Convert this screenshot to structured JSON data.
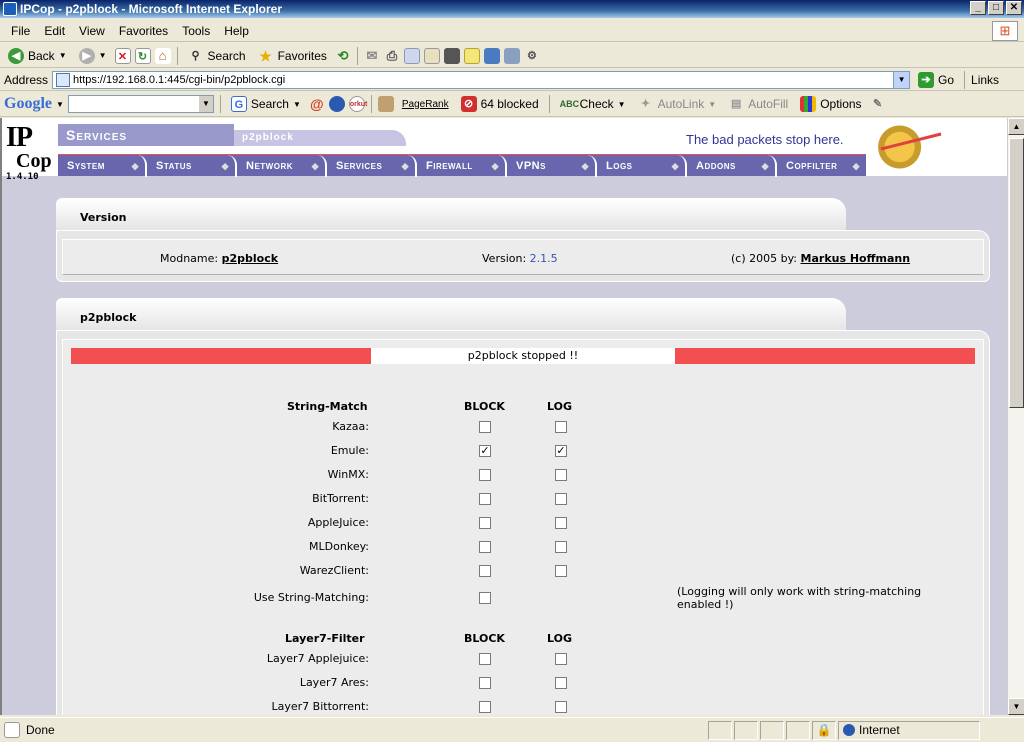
{
  "window": {
    "title": "IPCop - p2pblock - Microsoft Internet Explorer",
    "controls": [
      "_",
      "□",
      "✕"
    ]
  },
  "menu": {
    "items": [
      "File",
      "Edit",
      "View",
      "Favorites",
      "Tools",
      "Help"
    ]
  },
  "toolbar": {
    "back": "Back",
    "search": "Search",
    "favorites": "Favorites"
  },
  "address": {
    "label": "Address",
    "url": "https://192.168.0.1:445/cgi-bin/p2pblock.cgi",
    "go": "Go",
    "links": "Links"
  },
  "google": {
    "logo": "Google",
    "search": "Search",
    "pagerank": "PageRank",
    "blocked": "64 blocked",
    "check": "Check",
    "autolink": "AutoLink",
    "autofill": "AutoFill",
    "options": "Options"
  },
  "ipcop": {
    "version": "1.4.10",
    "section": "Services",
    "subsection": "p2pblock",
    "tagline": "The bad packets stop here.",
    "nav": [
      "System",
      "Status",
      "Network",
      "Services",
      "Firewall",
      "VPNs",
      "Logs",
      "Addons",
      "Copfilter"
    ]
  },
  "version_panel": {
    "title": "Version",
    "modname_label": "Modname:",
    "modname": "p2pblock",
    "version_label": "Version:",
    "version": "2.1.5",
    "copyright": "(c) 2005 by:",
    "author": "Markus Hoffmann"
  },
  "p2p_panel": {
    "title": "p2pblock",
    "status": "p2pblock stopped !!",
    "string_match_header": "String-Match",
    "block_header": "BLOCK",
    "log_header": "LOG",
    "string_rows": [
      {
        "label": "Kazaa:",
        "block": false,
        "log": false
      },
      {
        "label": "Emule:",
        "block": true,
        "log": true
      },
      {
        "label": "WinMX:",
        "block": false,
        "log": false
      },
      {
        "label": "BitTorrent:",
        "block": false,
        "log": false
      },
      {
        "label": "AppleJuice:",
        "block": false,
        "log": false
      },
      {
        "label": "MLDonkey:",
        "block": false,
        "log": false
      },
      {
        "label": "WarezClient:",
        "block": false,
        "log": false
      }
    ],
    "use_string_matching": {
      "label": "Use String-Matching:",
      "checked": false
    },
    "note": "(Logging will only work with string-matching enabled !)",
    "layer7_header": "Layer7-Filter",
    "layer7_rows": [
      {
        "label": "Layer7 Applejuice:",
        "block": false,
        "log": false
      },
      {
        "label": "Layer7 Ares:",
        "block": false,
        "log": false
      },
      {
        "label": "Layer7 Bittorrent:",
        "block": false,
        "log": false
      }
    ]
  },
  "status": {
    "text": "Done",
    "zone": "Internet"
  }
}
